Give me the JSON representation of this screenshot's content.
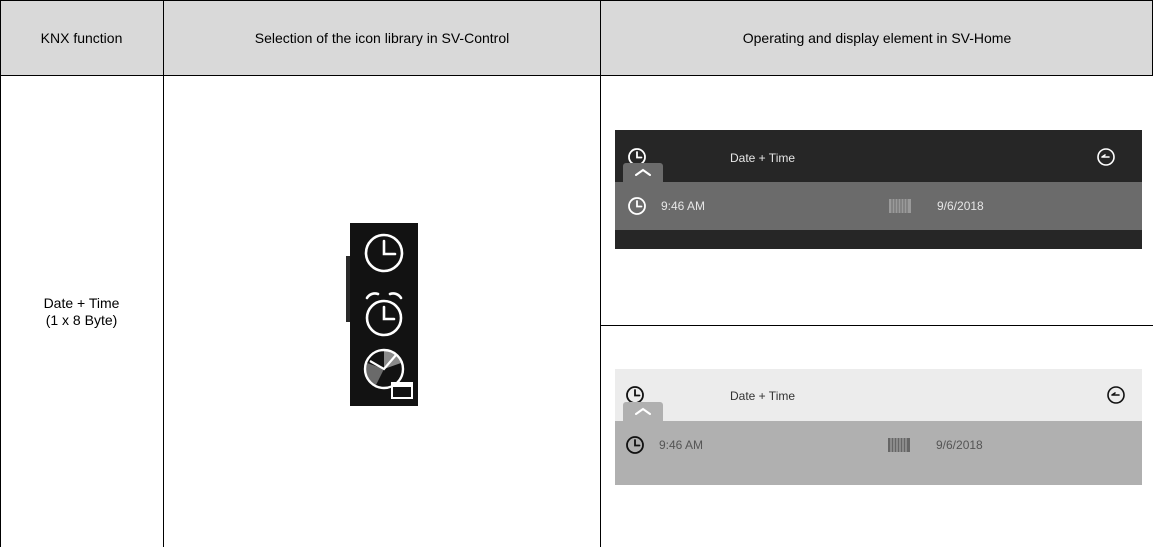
{
  "table": {
    "headers": {
      "knx_function": "KNX function",
      "icon_library": "Selection of the icon library in SV-Control",
      "sv_home": "Operating and display element in SV-Home"
    },
    "row": {
      "function_name": "Date + Time",
      "function_size": "(1 x 8 Byte)"
    }
  },
  "icon_library": {
    "icons": [
      "clock-icon",
      "alarm-clock-icon",
      "timer-calendar-icon"
    ]
  },
  "widgets": [
    {
      "theme": "dark",
      "title": "Date + Time",
      "time": "9:46 AM",
      "date": "9/6/2018",
      "colors": {
        "header": "#262626",
        "row": "#6b6b6b",
        "text": "#e6e6e6"
      }
    },
    {
      "theme": "light",
      "title": "Date + Time",
      "time": "9:46 AM",
      "date": "9/6/2018",
      "colors": {
        "header": "#ececec",
        "row": "#b0b0b0",
        "text": "#333333"
      }
    }
  ]
}
